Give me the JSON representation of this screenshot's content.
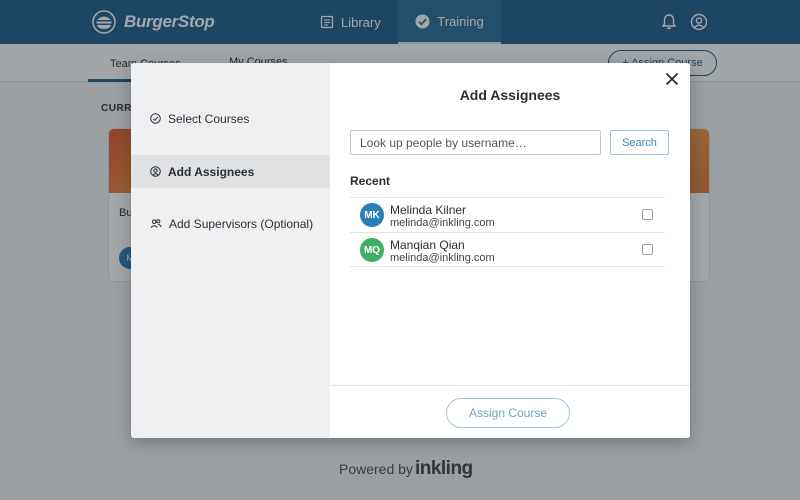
{
  "app": {
    "brand": "BurgerStop"
  },
  "topnav": {
    "tabs": [
      {
        "label": "Library",
        "icon": "book-icon"
      },
      {
        "label": "Training",
        "icon": "check-circle-icon",
        "active": true
      }
    ],
    "icons": [
      "bell-icon",
      "user-circle-icon"
    ]
  },
  "page": {
    "tabs": [
      "Team Courses",
      "My Courses"
    ],
    "assign_button": "+ Assign Course",
    "section_label": "CURRE",
    "cards": [
      {
        "title_fragment": "Bu",
        "avatar": "M"
      },
      {
        "title_fragment": ""
      }
    ],
    "powered_prefix": "Powered by",
    "powered_brand": "inkling"
  },
  "modal": {
    "steps": [
      {
        "label": "Select Courses",
        "icon": "check-circle-icon"
      },
      {
        "label": "Add Assignees",
        "icon": "user-circle-icon",
        "active": true
      },
      {
        "label": "Add Supervisors (Optional)",
        "icon": "users-icon"
      }
    ],
    "title": "Add Assignees",
    "search": {
      "placeholder": "Look up people by username…",
      "value": "",
      "button": "Search"
    },
    "recent_label": "Recent",
    "people": [
      {
        "initials": "MK",
        "name": "Melinda Kilner",
        "email": "melinda@inkling.com",
        "color": "#2d7eb5",
        "checked": false
      },
      {
        "initials": "MQ",
        "name": "Manqian Qian",
        "email": "melinda@inkling.com",
        "color": "#3fae64",
        "checked": false
      }
    ],
    "assign_button": "Assign Course"
  },
  "colors": {
    "topbar": "#1f5f8b",
    "accent": "#3f86b4"
  }
}
